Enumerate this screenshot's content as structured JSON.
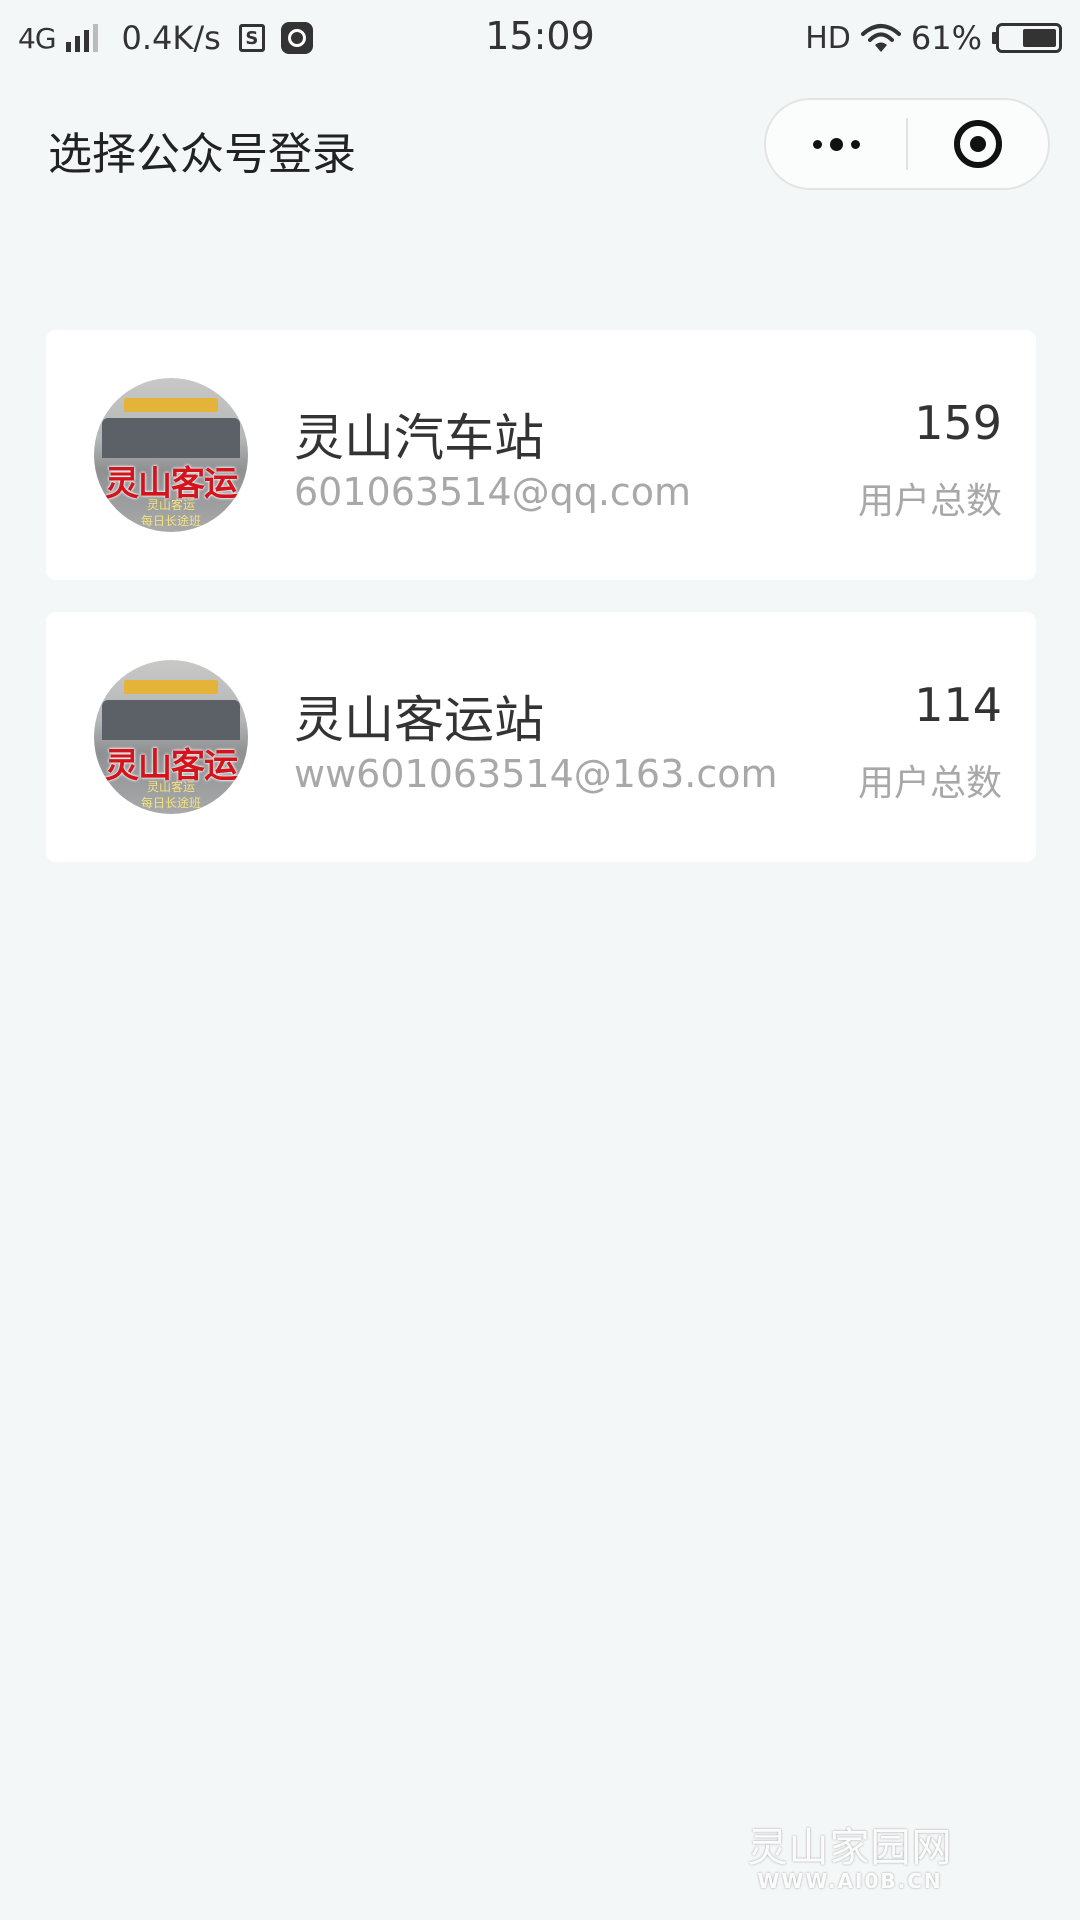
{
  "status_bar": {
    "network": "4G",
    "speed": "0.4K/s",
    "box_glyph": "S",
    "time": "15:09",
    "hd": "HD",
    "battery_percent": "61%",
    "battery_level": 0.61,
    "icons": [
      "signal-icon",
      "s-box-icon",
      "gauge-icon",
      "wifi-icon",
      "battery-icon"
    ]
  },
  "nav": {
    "title": "选择公众号登录",
    "capsule_icons": [
      "more-icon",
      "close-icon"
    ]
  },
  "accounts": [
    {
      "name": "灵山汽车站",
      "email": "601063514@qq.com",
      "count": "159",
      "count_label": "用户总数",
      "avatar_text": "灵山客运",
      "avatar_sub1": "灵山客运",
      "avatar_sub2": "每日长途班"
    },
    {
      "name": "灵山客运站",
      "email": "ww601063514@163.com",
      "count": "114",
      "count_label": "用户总数",
      "avatar_text": "灵山客运",
      "avatar_sub1": "灵山客运",
      "avatar_sub2": "每日长途班"
    }
  ],
  "watermark": {
    "title": "灵山家园网",
    "url": "WWW.AI0B.CN"
  },
  "colors": {
    "background": "#f4f7f7",
    "card": "#ffffff",
    "primary_text": "#333333",
    "secondary_text": "#a8a8a8",
    "avatar_red": "#d3141c"
  }
}
